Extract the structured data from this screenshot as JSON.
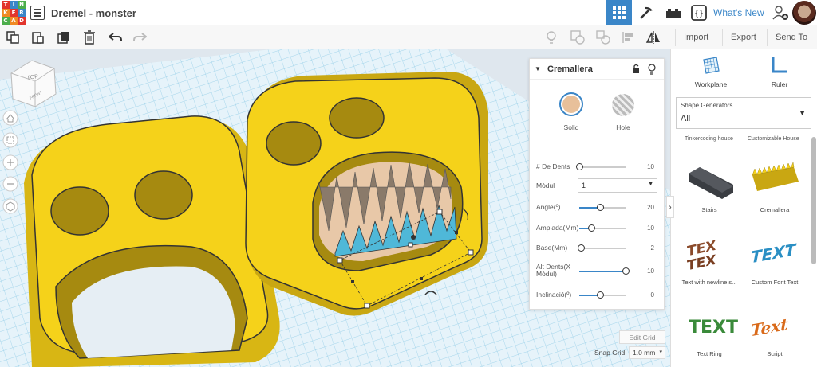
{
  "app": {
    "logo_letters": [
      "TIN",
      "KER",
      "CAD"
    ],
    "document_title": "Dremel - monster",
    "whats_new": "What's New"
  },
  "toolbar": {
    "import_label": "Import",
    "export_label": "Export",
    "send_to_label": "Send To"
  },
  "viewcube": {
    "top_label": "TOP",
    "front_label": "FRONT"
  },
  "inspector": {
    "title": "Cremallera",
    "solid_label": "Solid",
    "hole_label": "Hole",
    "properties": [
      {
        "label": "# De Dents",
        "value": "10",
        "fraction": 0.0
      },
      {
        "label": "Mòdul",
        "value": "1",
        "type": "select"
      },
      {
        "label": "Angle(º)",
        "value": "20",
        "fraction": 0.45
      },
      {
        "label": "Amplada(Mm)",
        "value": "10",
        "fraction": 0.25
      },
      {
        "label": "Base(Mm)",
        "value": "2",
        "fraction": 0.03
      },
      {
        "label": "Alt Dents(X Mòdul)",
        "value": "10",
        "fraction": 1.0
      },
      {
        "label": "Inclinació(º)",
        "value": "0",
        "fraction": 0.45
      }
    ]
  },
  "canvas": {
    "edit_grid_label": "Edit Grid",
    "snap_grid_label": "Snap Grid",
    "snap_grid_value": "1.0 mm"
  },
  "sidebar": {
    "workplane_label": "Workplane",
    "ruler_label": "Ruler",
    "generator_header": "Shape Generators",
    "generator_value": "All",
    "cut_labels": [
      "Tinkercoding house",
      "Customizable House"
    ],
    "shapes": [
      {
        "label": "Stairs"
      },
      {
        "label": "Cremallera"
      },
      {
        "label": "Text with newline s..."
      },
      {
        "label": "Custom Font Text"
      },
      {
        "label": "Text Ring"
      },
      {
        "label": "Script"
      }
    ]
  },
  "colors": {
    "accent": "#3a86c8",
    "shape_yellow": "#f5d21a",
    "grid": "#7fc4e3",
    "solid_orange": "#e8c09a"
  }
}
